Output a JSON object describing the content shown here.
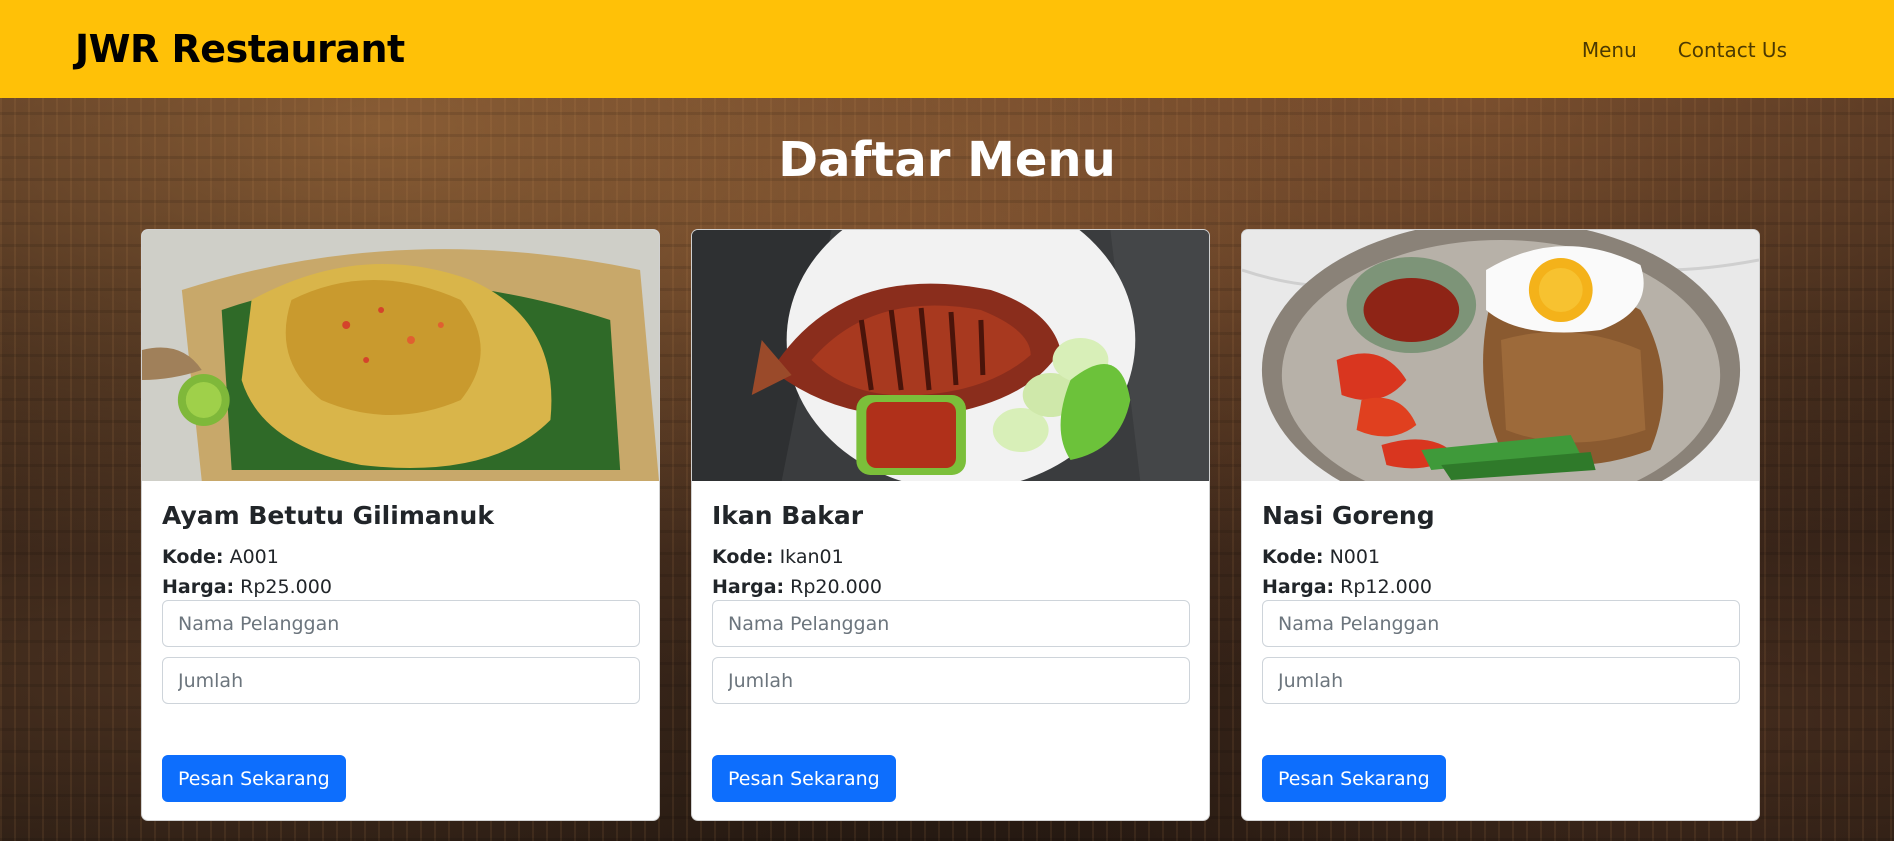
{
  "brand": "JWR Restaurant",
  "nav": [
    "Menu",
    "Contact Us"
  ],
  "page_title": "Daftar Menu",
  "labels": {
    "kode": "Kode:",
    "harga": "Harga:"
  },
  "colors": {
    "navbar": "#ffc107",
    "button": "#0d6efd"
  },
  "menu": [
    {
      "name": "Ayam Betutu Gilimanuk",
      "kode": "A001",
      "harga": "Rp25.000",
      "name_placeholder": "Nama Pelanggan",
      "qty_placeholder": "Jumlah",
      "button": "Pesan Sekarang",
      "image": "grilled-chicken-on-banana-leaf-image"
    },
    {
      "name": "Ikan Bakar",
      "kode": "Ikan01",
      "harga": "Rp20.000",
      "name_placeholder": "Nama Pelanggan",
      "qty_placeholder": "Jumlah",
      "button": "Pesan Sekarang",
      "image": "grilled-fish-plate-image"
    },
    {
      "name": "Nasi Goreng",
      "kode": "N001",
      "harga": "Rp12.000",
      "name_placeholder": "Nama Pelanggan",
      "qty_placeholder": "Jumlah",
      "button": "Pesan Sekarang",
      "image": "fried-rice-with-egg-image"
    }
  ]
}
